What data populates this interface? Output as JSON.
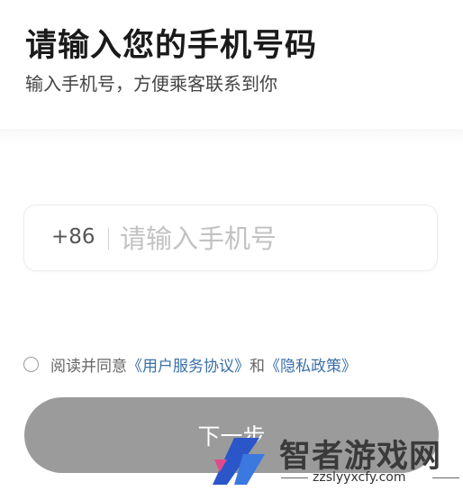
{
  "header": {
    "title": "请输入您的手机号码",
    "subtitle": "输入手机号，方便乘客联系到你"
  },
  "phone": {
    "country_code": "+86",
    "placeholder": "请输入手机号",
    "value": ""
  },
  "agreement": {
    "checked": false,
    "prefix": "阅读并同意",
    "terms_link": "《用户服务协议》",
    "conjunction": "和",
    "privacy_link": "《隐私政策》"
  },
  "next_button": {
    "label": "下一步"
  },
  "watermark": {
    "title": "智者游戏网",
    "url": "zzslyyxcfy.com"
  },
  "colors": {
    "button_bg": "#9b9b9b",
    "link": "#3a6fa8",
    "watermark_blue": "#2b56c9",
    "watermark_pink": "#e24a8c"
  }
}
